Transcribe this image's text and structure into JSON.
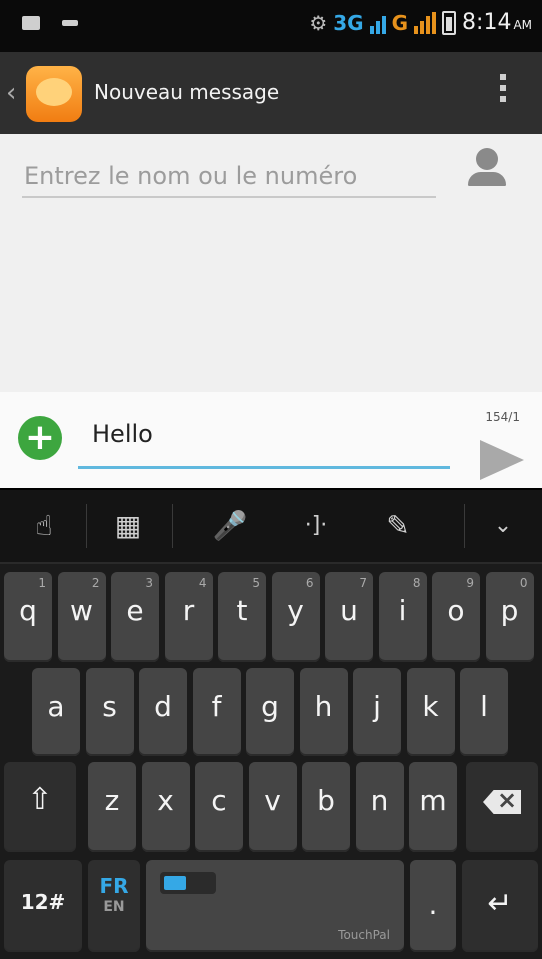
{
  "status_bar": {
    "network_1": "3G",
    "network_2": "G",
    "time": "8:14",
    "ampm": "AM"
  },
  "action_bar": {
    "title": "Nouveau message"
  },
  "recipient": {
    "placeholder": "Entrez le nom ou le numéro"
  },
  "compose": {
    "message": "Hello",
    "char_count": "154/1"
  },
  "keyboard": {
    "row1": [
      {
        "label": "q",
        "hint": "1"
      },
      {
        "label": "w",
        "hint": "2"
      },
      {
        "label": "e",
        "hint": "3"
      },
      {
        "label": "r",
        "hint": "4"
      },
      {
        "label": "t",
        "hint": "5"
      },
      {
        "label": "y",
        "hint": "6"
      },
      {
        "label": "u",
        "hint": "7"
      },
      {
        "label": "i",
        "hint": "8"
      },
      {
        "label": "o",
        "hint": "9"
      },
      {
        "label": "p",
        "hint": "0"
      }
    ],
    "row2": [
      {
        "label": "a"
      },
      {
        "label": "s"
      },
      {
        "label": "d"
      },
      {
        "label": "f"
      },
      {
        "label": "g"
      },
      {
        "label": "h"
      },
      {
        "label": "j"
      },
      {
        "label": "k"
      },
      {
        "label": "l"
      }
    ],
    "row3": [
      {
        "label": "z"
      },
      {
        "label": "x"
      },
      {
        "label": "c"
      },
      {
        "label": "v"
      },
      {
        "label": "b"
      },
      {
        "label": "n"
      },
      {
        "label": "m"
      }
    ],
    "symbols_label": "12#",
    "lang_primary": "FR",
    "lang_secondary": "EN",
    "period_label": ".",
    "space_brand": "TouchPal"
  },
  "colors": {
    "accent": "#35a8e6",
    "add_button": "#3da63f",
    "app_icon": "#f17d12"
  }
}
